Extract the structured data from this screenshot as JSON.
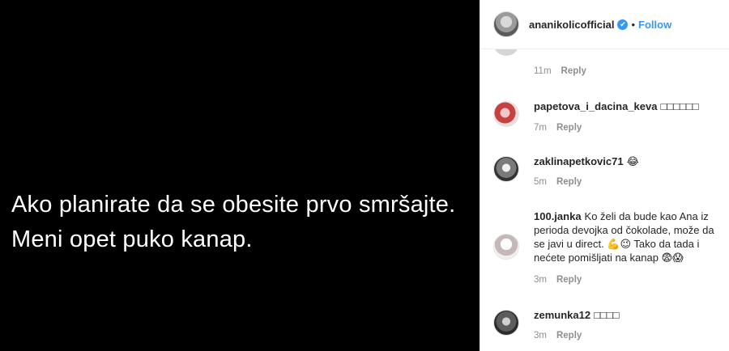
{
  "media": {
    "caption": "Ako planirate da se obesite prvo smršajte. Meni opet puko kanap."
  },
  "header": {
    "username": "ananikolicofficial",
    "verified_icon": "✔",
    "separator": "•",
    "follow_label": "Follow"
  },
  "stub": {
    "time": "11m",
    "reply_label": "Reply"
  },
  "comments": [
    {
      "username": "papetova_i_dacina_keva",
      "text": "□□□□□□",
      "time": "7m",
      "reply_label": "Reply"
    },
    {
      "username": "zaklinapetkovic71",
      "text": "😂",
      "time": "5m",
      "reply_label": "Reply"
    },
    {
      "username": "100.janka",
      "text": "Ko želi da bude kao Ana iz perioda devojka od čokolade, može da se javi u direct. 💪😉 Tako da tada i nećete pomišljati na kanap 😨😱",
      "time": "3m",
      "reply_label": "Reply"
    },
    {
      "username": "zemunka12",
      "text": "□□□□",
      "time": "3m",
      "reply_label": "Reply"
    }
  ]
}
